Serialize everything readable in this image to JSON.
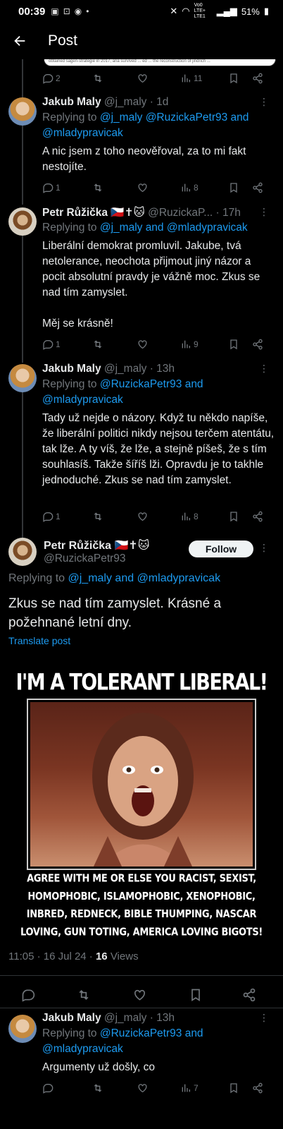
{
  "status_bar": {
    "time": "00:39",
    "icons_left": [
      "image-icon",
      "scan-icon",
      "game-icon",
      "dot-icon"
    ],
    "network": "Vo0 LTE+ LTE1",
    "battery": "51%"
  },
  "header": {
    "title": "Post"
  },
  "quote_card": {
    "text": "obtained sagen-strategie in 2017, aria survived ... ed ... the reconstruction of jindrich ..."
  },
  "tweets": [
    {
      "id": "t0",
      "stats": {
        "reply": "2",
        "retweet": "",
        "like": "",
        "views": "11"
      }
    },
    {
      "id": "t1",
      "name": "Jakub Maly",
      "handle": "@j_maly",
      "time": "· 1d",
      "reply_prefix": "Replying to ",
      "reply_mentions": "@j_maly @RuzickaPetr93 and @mladypravicak",
      "text": "A nic jsem z toho neověřoval, za to mi fakt nestojíte.",
      "stats": {
        "reply": "1",
        "retweet": "",
        "like": "",
        "views": "8"
      }
    },
    {
      "id": "t2",
      "name": "Petr Růžička 🇨🇿✝🐱",
      "handle": "@RuzickaP...",
      "time": "· 17h",
      "reply_prefix": "Replying to ",
      "reply_mentions": "@j_maly and @mladypravicak",
      "text": "Liberální demokrat promluvil. Jakube, tvá netolerance, neochota přijmout jiný názor a pocit absolutní pravdy je vážně moc. Zkus se nad tím zamyslet.\n\nMěj se krásně!",
      "stats": {
        "reply": "1",
        "retweet": "",
        "like": "",
        "views": "9"
      }
    },
    {
      "id": "t3",
      "name": "Jakub Maly",
      "handle": "@j_maly",
      "time": "· 13h",
      "reply_prefix": "Replying to ",
      "reply_mentions": "@RuzickaPetr93 and @mladypravicak",
      "text": "Tady už nejde o názory. Když tu někdo napíše, že liberální politici nikdy nejsou terčem atentátu, tak lže. A ty víš, že lže, a stejně píšeš, že s tím souhlasíš. Takže šíříš lži. Opravdu je to takhle jednoduché. Zkus se nad tím zamyslet.",
      "stats": {
        "reply": "1",
        "retweet": "",
        "like": "",
        "views": "8"
      }
    }
  ],
  "main_tweet": {
    "name": "Petr Růžička 🇨🇿✝🐱",
    "handle": "@RuzickaPetr93",
    "follow_label": "Follow",
    "reply_prefix": "Replying to ",
    "reply_mentions": "@j_maly and @mladypravicak",
    "text": "Zkus se nad tím zamyslet. Krásné a požehnané letní dny.",
    "translate_label": "Translate post",
    "meme": {
      "title": "I'M A TOLERANT LIBERAL!",
      "caption": "AGREE WITH ME OR ELSE YOU RACIST, SEXIST, HOMOPHOBIC, ISLAMOPHOBIC, XENOPHOBIC, INBRED, REDNECK, BIBLE THUMPING, NASCAR LOVING, GUN TOTING, AMERICA LOVING BIGOTS!"
    },
    "timestamp": "11:05 · 16 Jul 24 · ",
    "views_count": "16",
    "views_label": " Views"
  },
  "last_tweet": {
    "name": "Jakub Maly",
    "handle": "@j_maly",
    "time": "· 13h",
    "reply_prefix": "Replying to ",
    "reply_mentions": "@RuzickaPetr93 and @mladypravicak",
    "text": "Argumenty už došly, co",
    "stats": {
      "reply": "",
      "retweet": "",
      "like": "",
      "views": "7"
    }
  },
  "colors": {
    "link": "#1d9bf0",
    "muted": "#71767b",
    "text": "#e7e9ea",
    "background": "#000000"
  }
}
